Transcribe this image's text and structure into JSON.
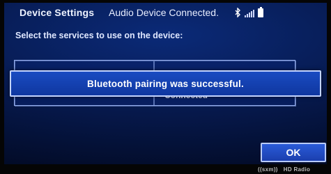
{
  "header": {
    "title": "Device Settings",
    "status": "Audio Device Connected.",
    "icons": [
      "bluetooth-icon",
      "signal-icon",
      "battery-icon"
    ]
  },
  "instruction": "Select the services to use on the device:",
  "services_table": {
    "rows": [
      [
        "",
        ""
      ],
      [
        "",
        "Connected"
      ]
    ]
  },
  "dialog": {
    "message": "Bluetooth pairing was successful.",
    "ok_label": "OK"
  },
  "footer": {
    "logos": [
      "((sxm))",
      "HD Radio"
    ]
  },
  "colors": {
    "screen_bg": "#06184a",
    "dialog_bg": "#1a4bc2",
    "border": "#c4d4ff"
  }
}
